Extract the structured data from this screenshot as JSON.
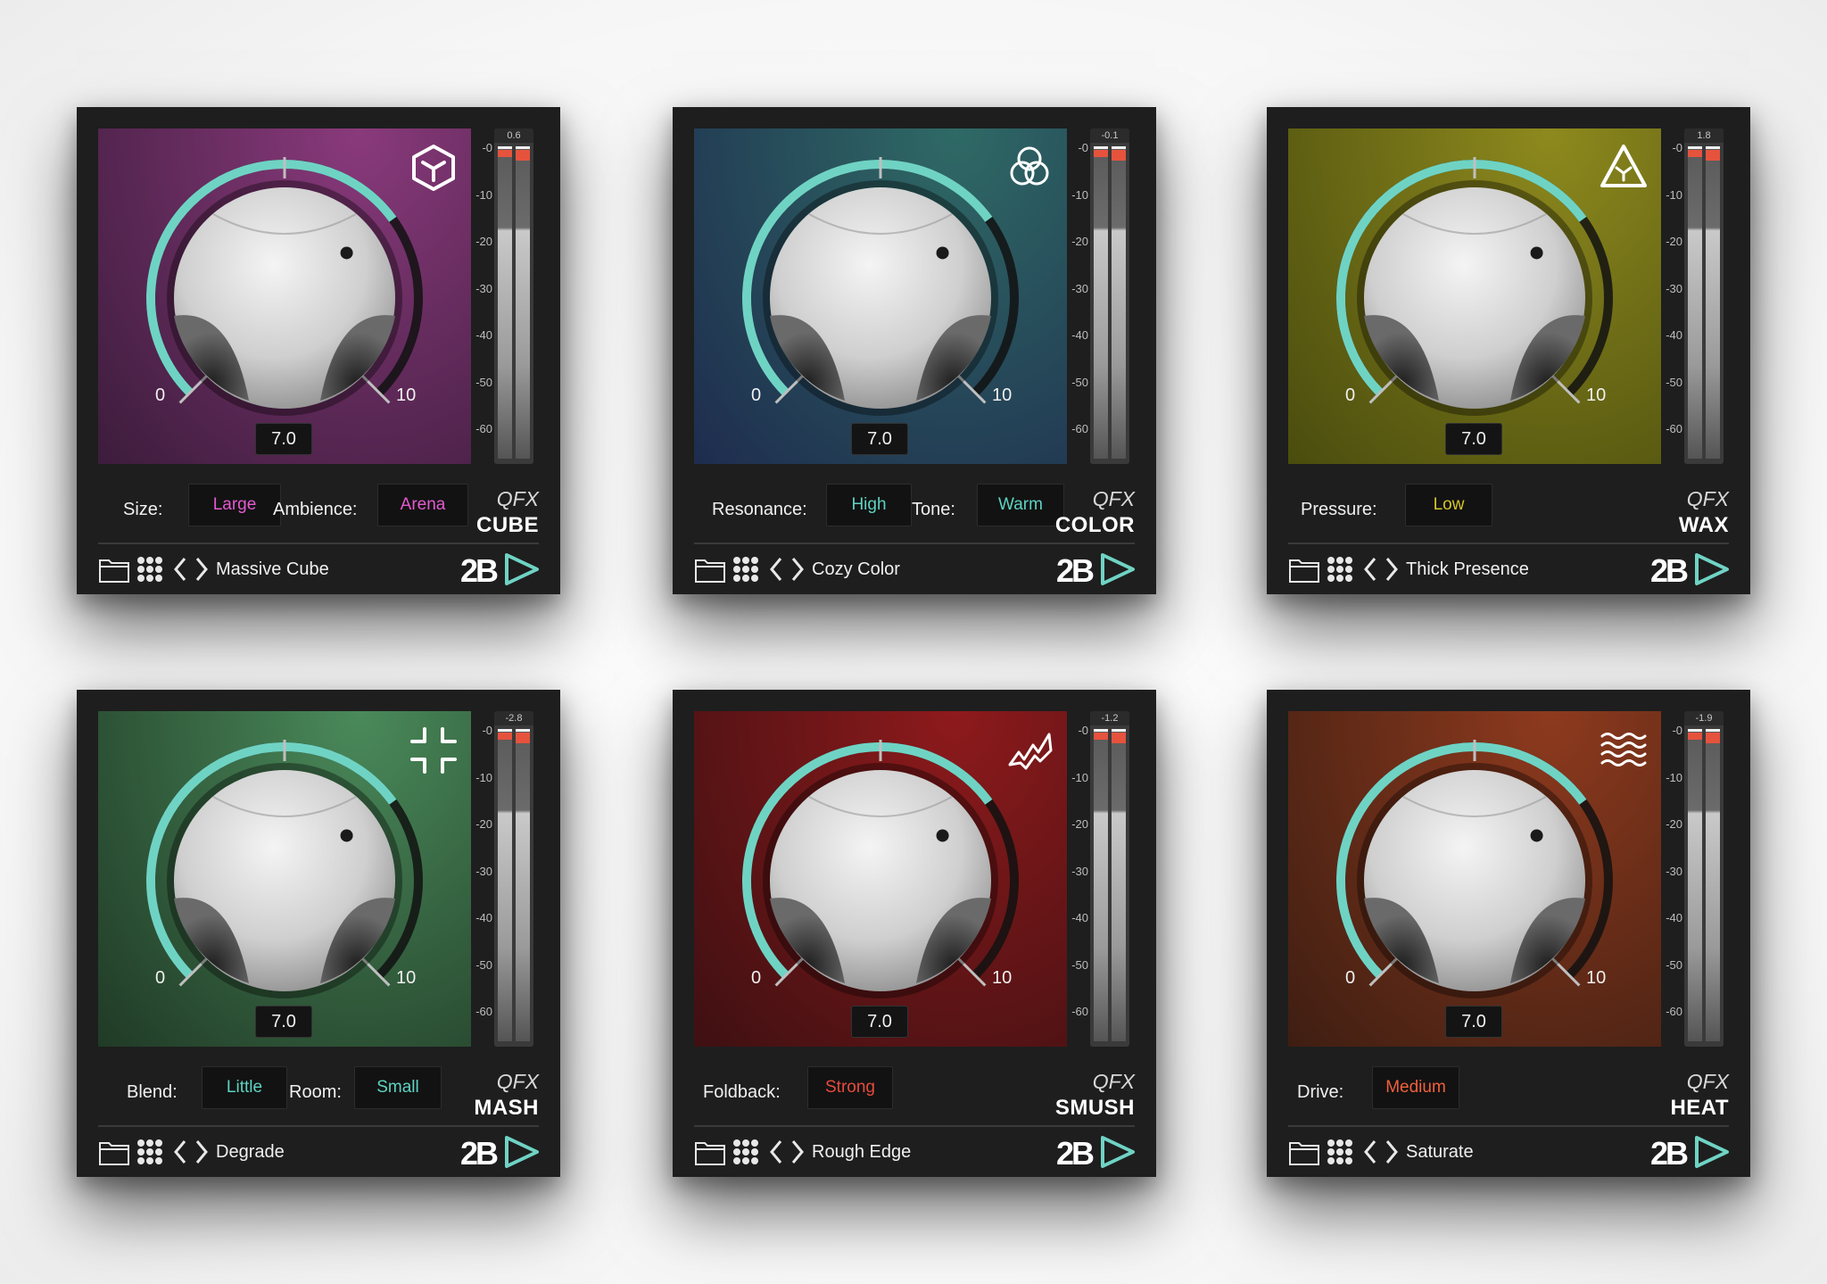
{
  "knob": {
    "value_label": "7.0",
    "min_label": "0",
    "max_label": "10",
    "value": 7.0,
    "min": 0,
    "max": 10
  },
  "meter_ticks": [
    "-0",
    "-10",
    "-20",
    "-30",
    "-40",
    "-50",
    "-60"
  ],
  "colors": {
    "accent": "#6fd3c4",
    "frame": "#1e1e1e"
  },
  "plugins": [
    {
      "id": "cube",
      "qfx": "QFX",
      "name": "CUBE",
      "preset": "Massive Cube",
      "peak": "0.6",
      "icon": "cube-icon",
      "panel_top": "#8a3a7c",
      "panel_bottom": "#3c1c3c",
      "value_color": "#e35ad0",
      "params": [
        {
          "label": "Size:",
          "value": "Large"
        },
        {
          "label": "Ambience:",
          "value": "Arena"
        }
      ]
    },
    {
      "id": "color",
      "qfx": "QFX",
      "name": "COLOR",
      "preset": "Cozy Color",
      "peak": "-0.1",
      "icon": "rings-icon",
      "panel_top": "#2f6a66",
      "panel_bottom": "#1e2c4e",
      "value_color": "#5ed3c2",
      "params": [
        {
          "label": "Resonance:",
          "value": "High"
        },
        {
          "label": "Tone:",
          "value": "Warm"
        }
      ]
    },
    {
      "id": "wax",
      "qfx": "QFX",
      "name": "WAX",
      "preset": "Thick Presence",
      "peak": "1.8",
      "icon": "triangle-icon",
      "panel_top": "#8e8a1e",
      "panel_bottom": "#4a4c0e",
      "value_color": "#d4c42a",
      "params": [
        {
          "label": "Pressure:",
          "value": "Low"
        }
      ]
    },
    {
      "id": "mash",
      "qfx": "QFX",
      "name": "MASH",
      "preset": "Degrade",
      "peak": "-2.8",
      "icon": "compress-icon",
      "panel_top": "#4a8a5a",
      "panel_bottom": "#203a26",
      "value_color": "#5ed3c2",
      "params": [
        {
          "label": "Blend:",
          "value": "Little"
        },
        {
          "label": "Room:",
          "value": "Small"
        }
      ]
    },
    {
      "id": "smush",
      "qfx": "QFX",
      "name": "SMUSH",
      "preset": "Rough Edge",
      "peak": "-1.2",
      "icon": "zigzag-icon",
      "panel_top": "#8e1a1c",
      "panel_bottom": "#3e1012",
      "value_color": "#e54b3c",
      "params": [
        {
          "label": "Foldback:",
          "value": "Strong"
        }
      ]
    },
    {
      "id": "heat",
      "qfx": "QFX",
      "name": "HEAT",
      "preset": "Saturate",
      "peak": "-1.9",
      "icon": "waves-icon",
      "panel_top": "#8e3a1e",
      "panel_bottom": "#3e1e12",
      "value_color": "#f0603c",
      "params": [
        {
          "label": "Drive:",
          "value": "Medium"
        }
      ]
    }
  ]
}
